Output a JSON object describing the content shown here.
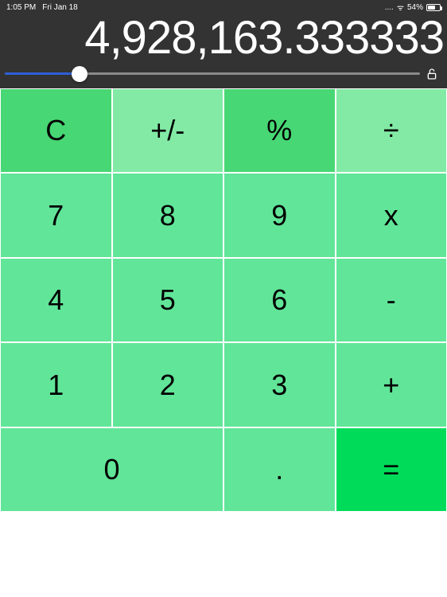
{
  "status_bar": {
    "time": "1:05 PM",
    "date": "Fri Jan 18",
    "signal_glyph": "....",
    "wifi_glyph": "ᯤ",
    "battery_percent": "54%"
  },
  "display": {
    "value": "4,928,163.333333"
  },
  "slider": {
    "position_percent": 18
  },
  "keys": {
    "clear": "C",
    "sign": "+/-",
    "percent": "%",
    "divide": "÷",
    "7": "7",
    "8": "8",
    "9": "9",
    "multiply": "x",
    "4": "4",
    "5": "5",
    "6": "6",
    "minus": "-",
    "1": "1",
    "2": "2",
    "3": "3",
    "plus": "+",
    "0": "0",
    "decimal": ".",
    "equals": "="
  }
}
